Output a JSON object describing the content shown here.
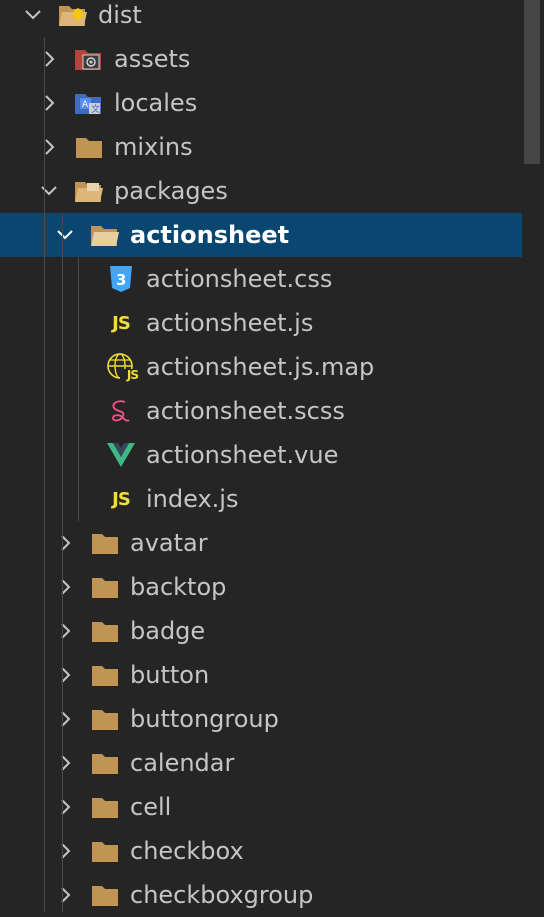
{
  "explorer": {
    "root": {
      "label": "dist",
      "expanded": true
    },
    "folders": {
      "assets": {
        "label": "assets"
      },
      "locales": {
        "label": "locales"
      },
      "mixins": {
        "label": "mixins"
      },
      "packages": {
        "label": "packages",
        "expanded": true
      }
    },
    "selected_folder": {
      "label": "actionsheet",
      "expanded": true
    },
    "files": [
      {
        "label": "actionsheet.css",
        "icon": "css3-icon"
      },
      {
        "label": "actionsheet.js",
        "icon": "javascript-icon",
        "badge": "JS"
      },
      {
        "label": "actionsheet.js.map",
        "icon": "js-map-icon",
        "badge": "JS"
      },
      {
        "label": "actionsheet.scss",
        "icon": "sass-icon"
      },
      {
        "label": "actionsheet.vue",
        "icon": "vue-icon"
      },
      {
        "label": "index.js",
        "icon": "javascript-icon",
        "badge": "JS"
      }
    ],
    "subfolders": [
      {
        "label": "avatar"
      },
      {
        "label": "backtop"
      },
      {
        "label": "badge"
      },
      {
        "label": "button"
      },
      {
        "label": "buttongroup"
      },
      {
        "label": "calendar"
      },
      {
        "label": "cell"
      },
      {
        "label": "checkbox"
      },
      {
        "label": "checkboxgroup"
      }
    ]
  },
  "colors": {
    "background": "#252526",
    "selection": "#094771",
    "text": "#c5c5c5",
    "folder": "#c09553",
    "js": "#f1dd35",
    "css": "#42a5f5",
    "sass": "#f55385",
    "vue": "#41b883"
  }
}
